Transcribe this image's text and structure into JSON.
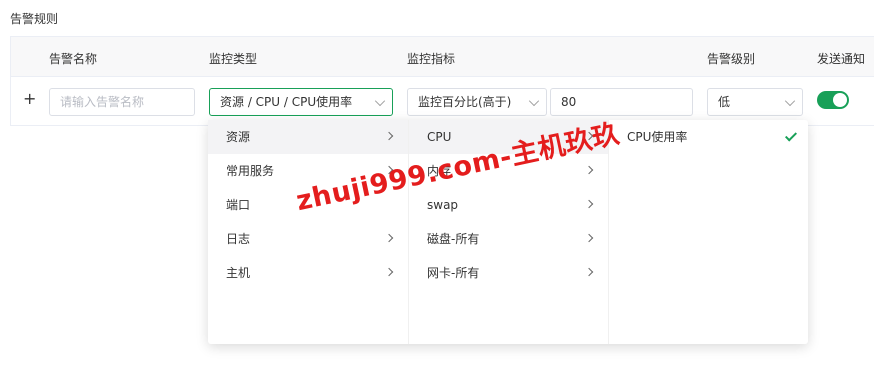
{
  "section_title": "告警规则",
  "table": {
    "headers": [
      "告警名称",
      "监控类型",
      "监控指标",
      "告警级别",
      "发送通知"
    ],
    "row": {
      "add_symbol": "+",
      "name_placeholder": "请输入告警名称",
      "monitor_type": "资源 / CPU / CPU使用率",
      "metric": "监控百分比(高于)",
      "threshold": "80",
      "level": "低",
      "notify_enabled": true
    }
  },
  "cascader": {
    "col1": [
      {
        "label": "资源",
        "has_children": true
      },
      {
        "label": "常用服务",
        "has_children": true
      },
      {
        "label": "端口",
        "has_children": false
      },
      {
        "label": "日志",
        "has_children": true
      },
      {
        "label": "主机",
        "has_children": true
      }
    ],
    "col2": [
      {
        "label": "CPU",
        "has_children": true
      },
      {
        "label": "内存",
        "has_children": true
      },
      {
        "label": "swap",
        "has_children": true
      },
      {
        "label": "磁盘-所有",
        "has_children": true
      },
      {
        "label": "网卡-所有",
        "has_children": true
      }
    ],
    "col3": [
      {
        "label": "CPU使用率",
        "selected": true
      }
    ]
  },
  "watermark": "zhuji999.com-主机玖玖",
  "colors": {
    "accent": "#18a058",
    "watermark": "#e41d1d"
  }
}
